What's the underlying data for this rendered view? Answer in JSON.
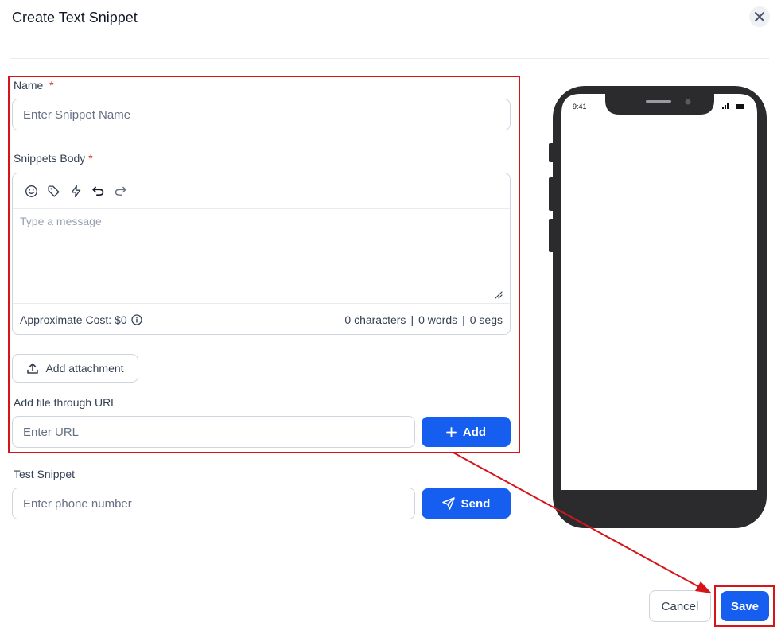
{
  "modal": {
    "title": "Create Text Snippet"
  },
  "name_field": {
    "label": "Name",
    "required_mark": "*",
    "placeholder": "Enter Snippet Name",
    "value": ""
  },
  "snippet_body": {
    "label": "Snippets Body",
    "required_mark": "*",
    "toolbar": [
      "emoji-icon",
      "tag-icon",
      "lightning-icon",
      "undo-icon",
      "redo-icon"
    ],
    "placeholder": "Type a message",
    "value": "",
    "cost_label": "Approximate Cost: $0",
    "characters": "0 characters",
    "words": "0 words",
    "segments": "0 segs",
    "separator": "|"
  },
  "attachment": {
    "button_label": "Add attachment"
  },
  "url_field": {
    "label": "Add file through URL",
    "placeholder": "Enter URL",
    "value": "",
    "add_label": "Add"
  },
  "test_snippet": {
    "label": "Test Snippet",
    "placeholder": "Enter phone number",
    "value": "",
    "send_label": "Send"
  },
  "footer": {
    "cancel_label": "Cancel",
    "save_label": "Save"
  },
  "phone_preview": {
    "time": "9:41"
  },
  "colors": {
    "primary": "#155eef",
    "highlight": "#d6151b",
    "phone_body": "#2b2b2e"
  }
}
